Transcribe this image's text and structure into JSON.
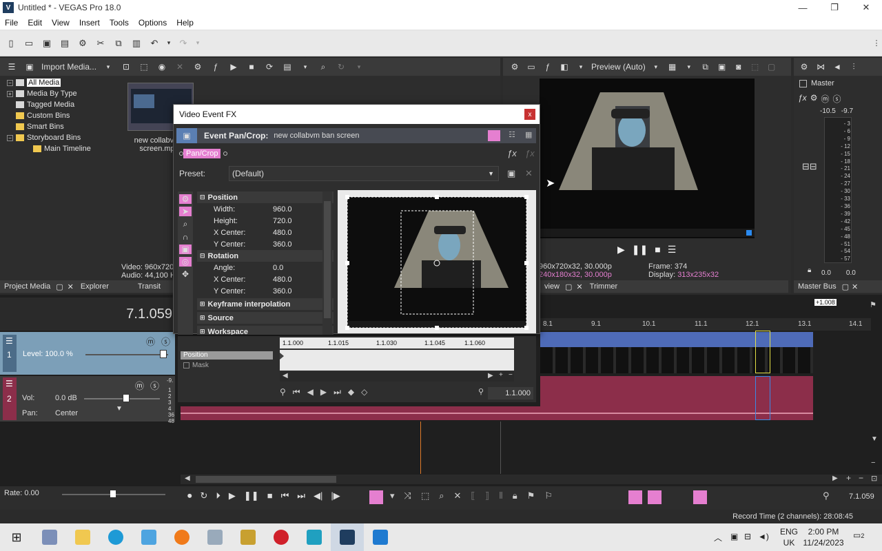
{
  "window": {
    "title": "Untitled * - VEGAS Pro 18.0",
    "logo": "V",
    "minimize_glyph": "—",
    "restore_glyph": "❐",
    "close_glyph": "✕"
  },
  "menu": [
    "File",
    "Edit",
    "View",
    "Insert",
    "Tools",
    "Options",
    "Help"
  ],
  "media_toolbar": {
    "import_label": "Import Media..."
  },
  "media_tree": [
    {
      "label": "All Media",
      "level": 1,
      "selected": true
    },
    {
      "label": "Media By Type",
      "level": 1
    },
    {
      "label": "Tagged Media",
      "level": 1
    },
    {
      "label": "Custom Bins",
      "level": 1
    },
    {
      "label": "Smart Bins",
      "level": 1
    },
    {
      "label": "Storyboard Bins",
      "level": 1
    },
    {
      "label": "Main Timeline",
      "level": 2
    }
  ],
  "media_item": {
    "name_line1": "new collabvm",
    "name_line2": "screen.mp",
    "video_info": "Video: 960x720",
    "audio_info": "Audio: 44,100 H"
  },
  "left_tabs": {
    "project_media": "Project Media",
    "explorer": "Explorer",
    "transitions": "Transit"
  },
  "preview": {
    "mode": "Preview (Auto)",
    "project_line": "960x720x32, 30.000p",
    "preview_line": "240x180x32, 30.000p",
    "frame_label": "Frame:",
    "frame_value": "374",
    "display_label": "Display:",
    "display_value": "313x235x32",
    "tab_preview": "view",
    "tab_trimmer": "Trimmer"
  },
  "master": {
    "label": "Master",
    "bus_label": "Master Bus",
    "peak_left": "-10.5",
    "peak_right": "-9.7",
    "scale": [
      "3",
      "6",
      "9",
      "12",
      "15",
      "18",
      "21",
      "24",
      "27",
      "30",
      "33",
      "36",
      "39",
      "42",
      "45",
      "48",
      "51",
      "54",
      "57"
    ],
    "bottom_left": "0.0",
    "bottom_right": "0.0"
  },
  "fx_dialog": {
    "title": "Video Event FX",
    "close": "x",
    "chain_label": "Event Pan/Crop:",
    "chain_value": "new collabvm ban screen",
    "plugin_chip": "Pan/Crop",
    "preset_label": "Preset:",
    "preset_value": "(Default)",
    "sections": {
      "position": "Position",
      "rotation": "Rotation",
      "keyframe": "Keyframe interpolation",
      "source": "Source",
      "workspace": "Workspace"
    },
    "position_props": [
      {
        "name": "Width:",
        "value": "960.0"
      },
      {
        "name": "Height:",
        "value": "720.0"
      },
      {
        "name": "X Center:",
        "value": "480.0"
      },
      {
        "name": "Y Center:",
        "value": "360.0"
      }
    ],
    "rotation_props": [
      {
        "name": "Angle:",
        "value": "0.0"
      },
      {
        "name": "X Center:",
        "value": "480.0"
      },
      {
        "name": "Y Center:",
        "value": "360.0"
      }
    ],
    "kf_tracks": [
      "Position",
      "Mask"
    ],
    "kf_ruler": [
      "1.1.000",
      "1.1.015",
      "1.1.030",
      "1.1.045",
      "1.1.060"
    ],
    "kf_time": "1.1.000"
  },
  "timeline": {
    "current_time": "7.1.059",
    "ruler": [
      "8.1",
      "9.1",
      "10.1",
      "11.1",
      "12.1",
      "13.1",
      "14.1"
    ],
    "end_marker": "+1.008",
    "video_track": {
      "number": "1",
      "level_label": "Level: 100.0 %"
    },
    "audio_track": {
      "number": "2",
      "vol_label": "Vol:",
      "vol_value": "0.0 dB",
      "pan_label": "Pan:",
      "pan_value": "Center",
      "meter_top": "-9.",
      "meter_nums": [
        "1",
        "2",
        "3",
        "4",
        "36",
        "48"
      ]
    },
    "rate_label": "Rate: 0.00",
    "end_time": "7.1.059"
  },
  "status": {
    "record_time": "Record Time (2 channels): 28:08:45"
  },
  "taskbar": {
    "lang_top": "ENG",
    "lang_bottom": "UK",
    "time": "2:00 PM",
    "date": "11/24/2023",
    "notif_count": "2"
  },
  "colors": {
    "accent_pink": "#e57fd0",
    "video_clip": "#4e6bb8",
    "audio_clip": "#8c2e4a",
    "video_track_header": "#7c9fb8"
  }
}
